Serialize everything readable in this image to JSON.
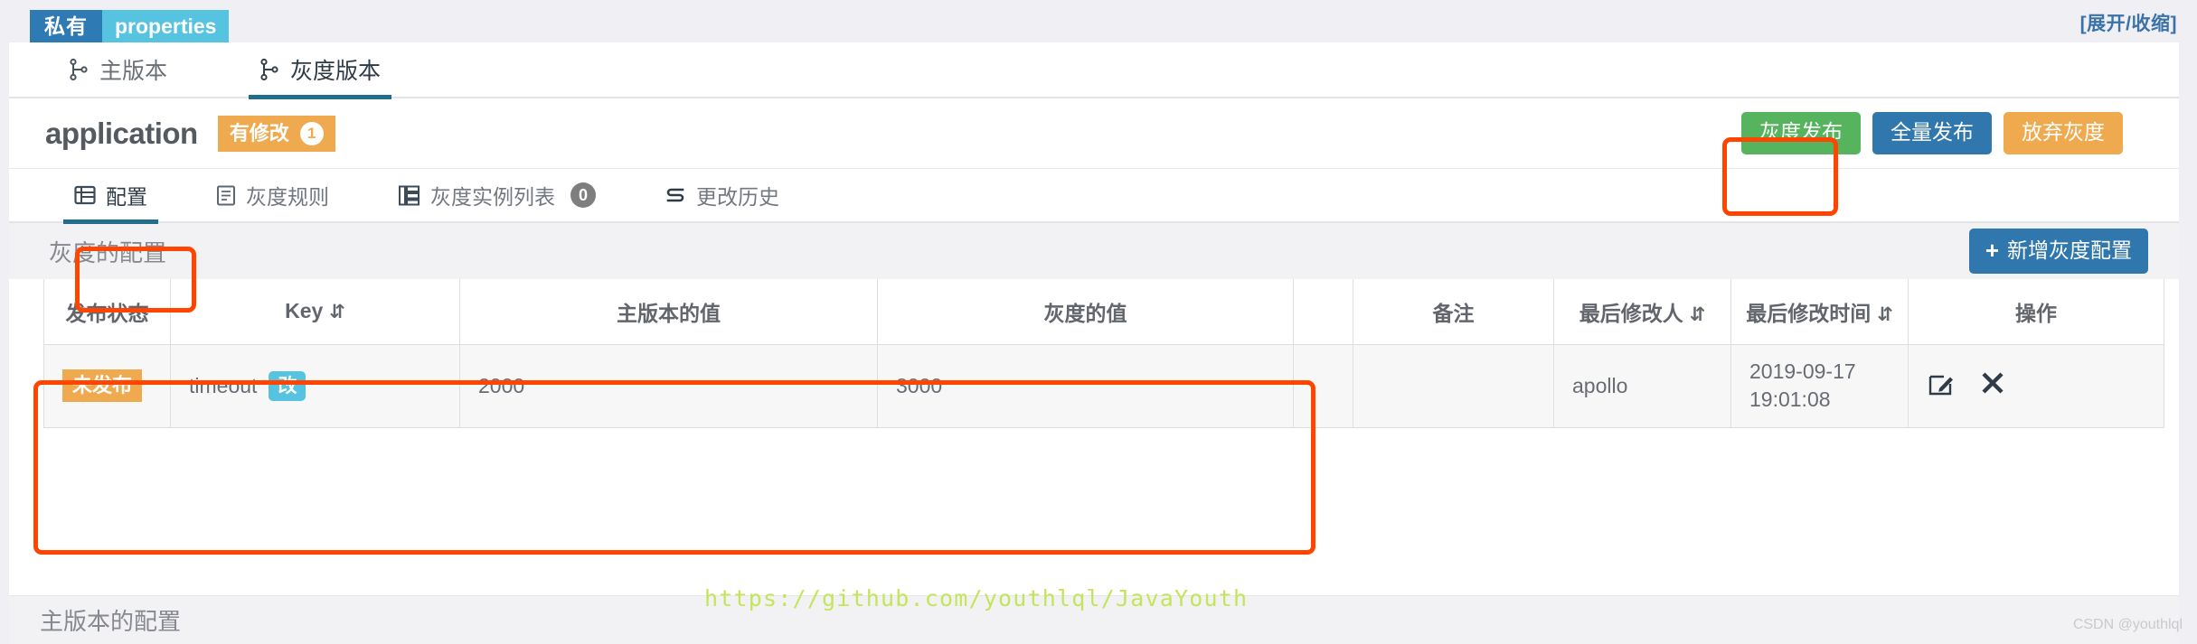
{
  "namespace_bar": {
    "scope_label": "私有",
    "format_label": "properties",
    "toggle_label": "[展开/收缩]"
  },
  "version_tabs": [
    {
      "label": "主版本",
      "icon": "branch-icon",
      "active": false
    },
    {
      "label": "灰度版本",
      "icon": "branch-icon",
      "active": true
    }
  ],
  "app_header": {
    "name": "application",
    "modified_badge": "有修改",
    "modified_count": "1",
    "buttons": [
      {
        "label": "灰度发布",
        "color": "#56b45e"
      },
      {
        "label": "全量发布",
        "color": "#2f77ac"
      },
      {
        "label": "放弃灰度",
        "color": "#efa94e"
      }
    ]
  },
  "inner_tabs": [
    {
      "label": "配置",
      "icon": "table-icon",
      "active": true,
      "badge": ""
    },
    {
      "label": "灰度规则",
      "icon": "document-icon",
      "active": false,
      "badge": ""
    },
    {
      "label": "灰度实例列表",
      "icon": "server-list-icon",
      "active": false,
      "badge": "0"
    },
    {
      "label": "更改历史",
      "icon": "history-exchange-icon",
      "active": false,
      "badge": ""
    }
  ],
  "gray_section": {
    "title": "灰度的配置",
    "add_button": "新增灰度配置",
    "add_icon": "plus-icon"
  },
  "table": {
    "columns": [
      {
        "label": "发布状态",
        "sortable": false
      },
      {
        "label": "Key",
        "sortable": true
      },
      {
        "label": "主版本的值",
        "sortable": false
      },
      {
        "label": "灰度的值",
        "sortable": false
      },
      {
        "label": "",
        "sortable": false
      },
      {
        "label": "备注",
        "sortable": false
      },
      {
        "label": "最后修改人",
        "sortable": true
      },
      {
        "label": "最后修改时间",
        "sortable": true
      },
      {
        "label": "操作",
        "sortable": false
      }
    ],
    "sort_icon": "sort-updown-icon",
    "rows": [
      {
        "status": "未发布",
        "key": "timeout",
        "key_tag": "改",
        "master_value": "2000",
        "gray_value": "3000",
        "spacer": "",
        "comment": "",
        "last_modified_by": "apollo",
        "last_modified_time": "2019-09-17 19:01:08",
        "actions": [
          {
            "icon": "edit-icon"
          },
          {
            "icon": "delete-icon"
          }
        ]
      }
    ]
  },
  "master_section": {
    "title": "主版本的配置"
  },
  "watermarks": {
    "github": "https://github.com/youthlql/JavaYouth",
    "csdn": "CSDN @youthlql"
  },
  "annotation_color": "#ff4500"
}
